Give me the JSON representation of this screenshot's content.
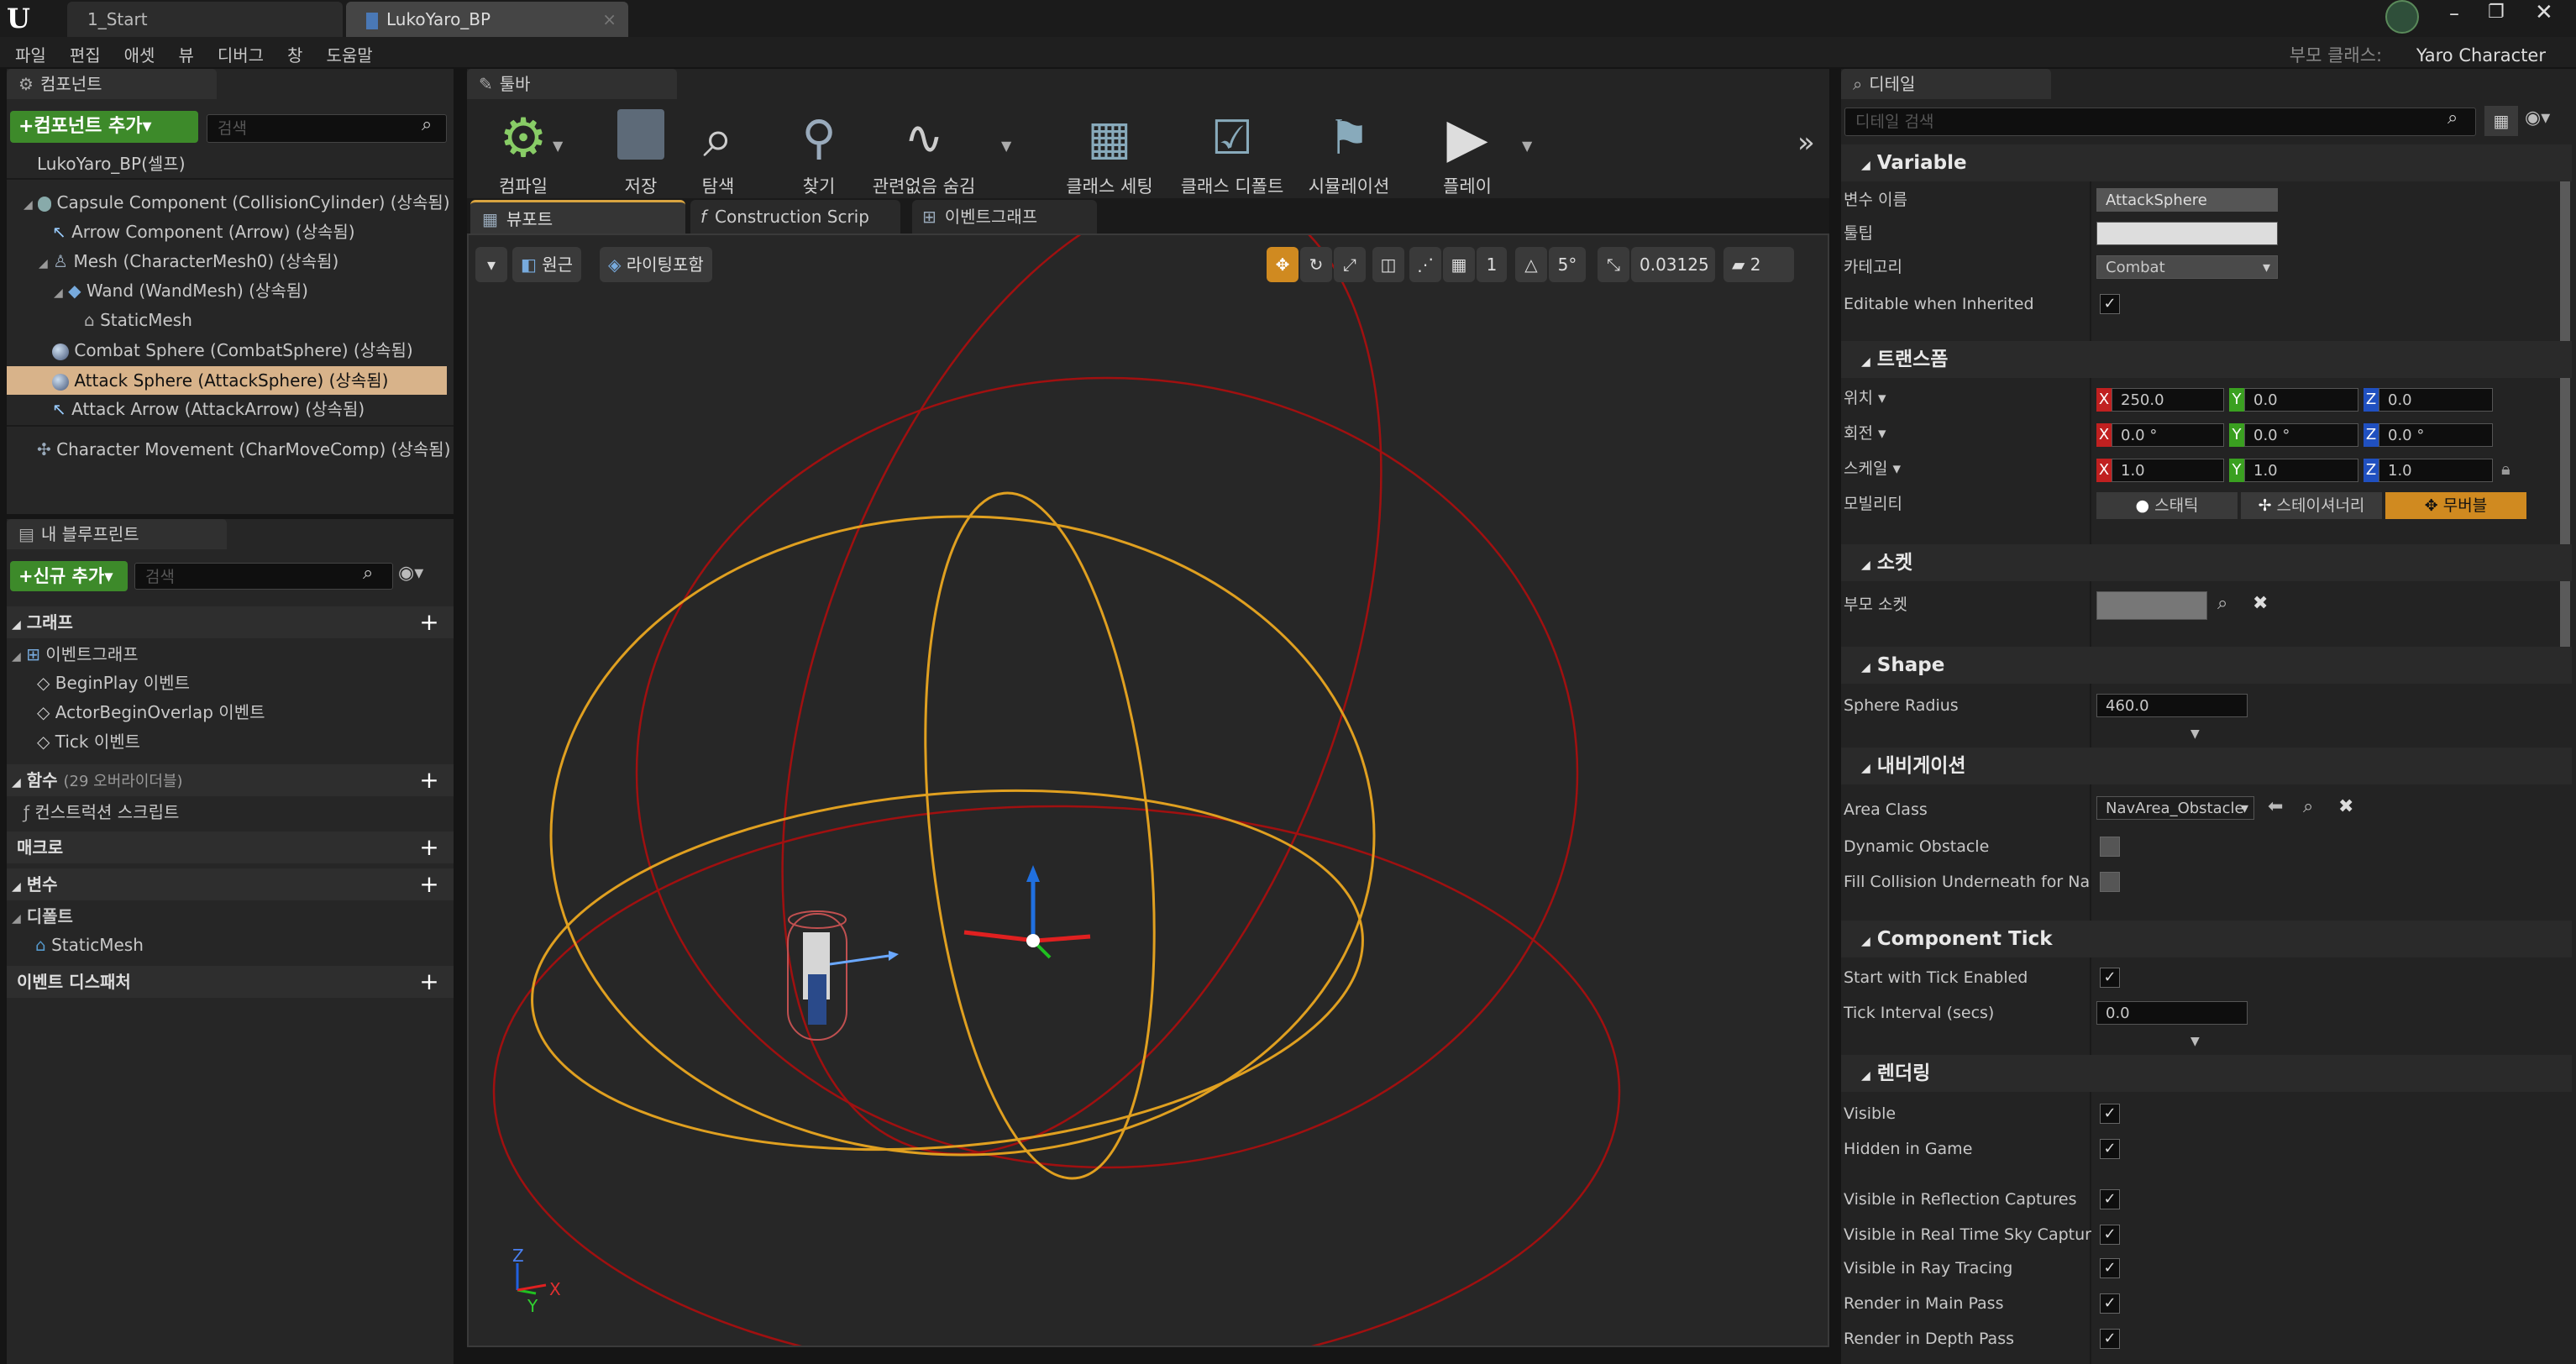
{
  "window": {
    "tabs": [
      "1_Start",
      "LukoYaro_BP"
    ],
    "parent_class_label": "부모 클래스:",
    "parent_class_value": "Yaro Character"
  },
  "menu": [
    "파일",
    "편집",
    "애셋",
    "뷰",
    "디버그",
    "창",
    "도움말"
  ],
  "components_panel": {
    "tab": "컴포넌트",
    "add_button": "+컴포넌트 추가▾",
    "search_placeholder": "검색",
    "root": "LukoYaro_BP(셀프)",
    "items": [
      "Capsule Component (CollisionCylinder) (상속됨)",
      "Arrow Component (Arrow) (상속됨)",
      "Mesh (CharacterMesh0) (상속됨)",
      "Wand (WandMesh) (상속됨)",
      "StaticMesh",
      "Combat Sphere (CombatSphere) (상속됨)",
      "Attack Sphere (AttackSphere) (상속됨)",
      "Attack Arrow (AttackArrow) (상속됨)",
      "Character Movement (CharMoveComp) (상속됨)"
    ]
  },
  "blueprint_panel": {
    "tab": "내 블루프린트",
    "add_button": "+신규 추가▾",
    "search_placeholder": "검색",
    "graph_section": "그래프",
    "event_graph": "이벤트그래프",
    "events": [
      "BeginPlay 이벤트",
      "ActorBeginOverlap 이벤트",
      "Tick 이벤트"
    ],
    "functions_section": "함수",
    "functions_note": "(29 오버라이더블)",
    "construction_script": "컨스트럭션 스크립트",
    "macro_section": "매크로",
    "variables_section": "변수",
    "default_label": "디폴트",
    "default_item": "StaticMesh",
    "dispatcher_section": "이벤트 디스패처"
  },
  "toolbar": {
    "tab": "툴바",
    "buttons": [
      "컴파일",
      "저장",
      "탐색",
      "찾기",
      "관련없음 숨김",
      "클래스 세팅",
      "클래스 디폴트",
      "시뮬레이션",
      "플레이"
    ]
  },
  "editor_tabs": [
    "뷰포트",
    "Construction Scrip",
    "이벤트그래프"
  ],
  "viewport": {
    "perspective": "원근",
    "lighting": "라이팅포함",
    "grid_snap": "1",
    "rot_snap": "5°",
    "scale_snap": "0.03125",
    "camera_speed": "2",
    "axis_y": "Y",
    "axis_x": "X",
    "axis_z": "Z",
    "colors": {
      "combat_sphere": "#e0a020",
      "attack_sphere": "#a01010"
    }
  },
  "details": {
    "tab": "디테일",
    "search_placeholder": "디테일 검색",
    "sections": {
      "variable": "Variable",
      "transform": "트랜스폼",
      "socket": "소켓",
      "shape": "Shape",
      "navigation": "내비게이션",
      "component_tick": "Component Tick",
      "rendering": "렌더링"
    },
    "variable_name_label": "변수 이름",
    "variable_name_value": "AttackSphere",
    "tooltip_label": "툴팁",
    "category_label": "카테고리",
    "category_value": "Combat",
    "editable_label": "Editable when Inherited",
    "location_label": "위치",
    "location": [
      "250.0",
      "0.0",
      "0.0"
    ],
    "rotation_label": "회전",
    "rotation": [
      "0.0 °",
      "0.0 °",
      "0.0 °"
    ],
    "scale_label": "스케일",
    "scale": [
      "1.0",
      "1.0",
      "1.0"
    ],
    "mobility_label": "모빌리티",
    "mobility_options": [
      "스태틱",
      "스테이셔너리",
      "무버블"
    ],
    "parent_socket_label": "부모 소켓",
    "sphere_radius_label": "Sphere Radius",
    "sphere_radius_value": "460.0",
    "area_class_label": "Area Class",
    "area_class_value": "NavArea_Obstacle",
    "dynamic_obstacle_label": "Dynamic Obstacle",
    "fill_collision_label": "Fill Collision Underneath for Na",
    "start_tick_label": "Start with Tick Enabled",
    "tick_interval_label": "Tick Interval (secs)",
    "tick_interval_value": "0.0",
    "render_rows": [
      "Visible",
      "Hidden in Game",
      "Visible in Reflection Captures",
      "Visible in Real Time Sky Captur",
      "Visible in Ray Tracing",
      "Render in Main Pass",
      "Render in Depth Pass"
    ]
  }
}
